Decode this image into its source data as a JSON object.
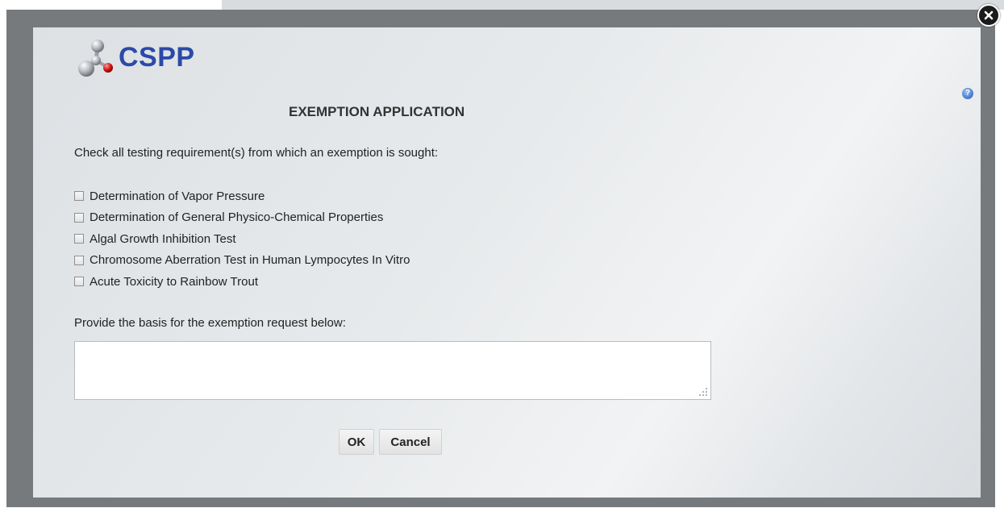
{
  "app": {
    "logo_text": "CSPP"
  },
  "header": {
    "title": "EXEMPTION APPLICATION",
    "help_icon": "question-circle-icon"
  },
  "form": {
    "instructions": "Check all testing requirement(s) from which an exemption is sought:",
    "requirements": [
      {
        "label": "Determination of Vapor Pressure",
        "checked": false
      },
      {
        "label": "Determination of General Physico-Chemical Properties",
        "checked": false
      },
      {
        "label": "Algal Growth Inhibition Test",
        "checked": false
      },
      {
        "label": "Chromosome Aberration Test in Human Lympocytes In Vitro",
        "checked": false
      },
      {
        "label": "Acute Toxicity to Rainbow Trout",
        "checked": false
      }
    ],
    "basis_label": "Provide the basis for the exemption request below:",
    "basis_value": "",
    "basis_placeholder": ""
  },
  "actions": {
    "ok_label": "OK",
    "cancel_label": "Cancel"
  },
  "colors": {
    "logo_blue": "#2b4aa8",
    "frame_gray": "#777a7d",
    "panel_bg": "#e7eaec"
  }
}
